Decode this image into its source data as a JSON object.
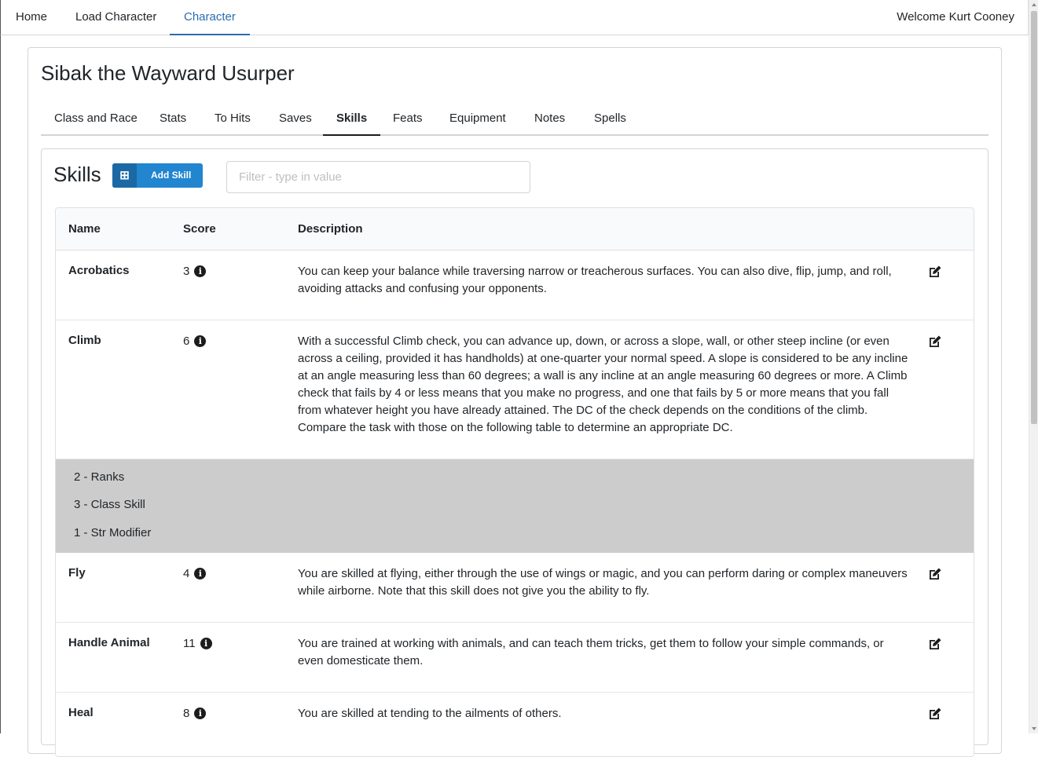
{
  "nav": {
    "home": "Home",
    "load_character": "Load Character",
    "character": "Character",
    "welcome": "Welcome Kurt Cooney"
  },
  "character": {
    "name": "Sibak the Wayward Usurper"
  },
  "tabs": [
    "Class and Race",
    "Stats",
    "To Hits",
    "Saves",
    "Skills",
    "Feats",
    "Equipment",
    "Notes",
    "Spells"
  ],
  "active_tab": "Skills",
  "skills_panel": {
    "heading": "Skills",
    "add_button": "Add Skill",
    "filter_placeholder": "Filter - type in value"
  },
  "table": {
    "headers": {
      "name": "Name",
      "score": "Score",
      "description": "Description"
    },
    "rows": [
      {
        "name": "Acrobatics",
        "score": "3",
        "description": "You can keep your balance while traversing narrow or treacherous surfaces. You can also dive, flip, jump, and roll, avoiding attacks and confusing your opponents."
      },
      {
        "name": "Climb",
        "score": "6",
        "description": "With a successful Climb check, you can advance up, down, or across a slope, wall, or other steep incline (or even across a ceiling, provided it has handholds) at one-quarter your normal speed. A slope is considered to be any incline at an angle measuring less than 60 degrees; a wall is any incline at an angle measuring 60 degrees or more. A Climb check that fails by 4 or less means that you make no progress, and one that fails by 5 or more means that you fall from whatever height you have already attained. The DC of the check depends on the conditions of the climb. Compare the task with those on the following table to determine an appropriate DC."
      },
      {
        "name": "Fly",
        "score": "4",
        "description": "You are skilled at flying, either through the use of wings or magic, and you can perform daring or complex maneuvers while airborne. Note that this skill does not give you the ability to fly."
      },
      {
        "name": "Handle Animal",
        "score": "11",
        "description": "You are trained at working with animals, and can teach them tricks, get them to follow your simple commands, or even domesticate them."
      },
      {
        "name": "Heal",
        "score": "8",
        "description": "You are skilled at tending to the ailments of others."
      }
    ],
    "climb_breakdown": [
      "2 - Ranks",
      "3 - Class Skill",
      "1 - Str Modifier"
    ]
  },
  "icons": {
    "info": "info-circle-icon",
    "edit": "edit-icon",
    "add": "plus-square-icon"
  },
  "colors": {
    "accent": "#2185d0",
    "nav_active": "#2b6cb0",
    "breakdown_bg": "#cccccc"
  }
}
